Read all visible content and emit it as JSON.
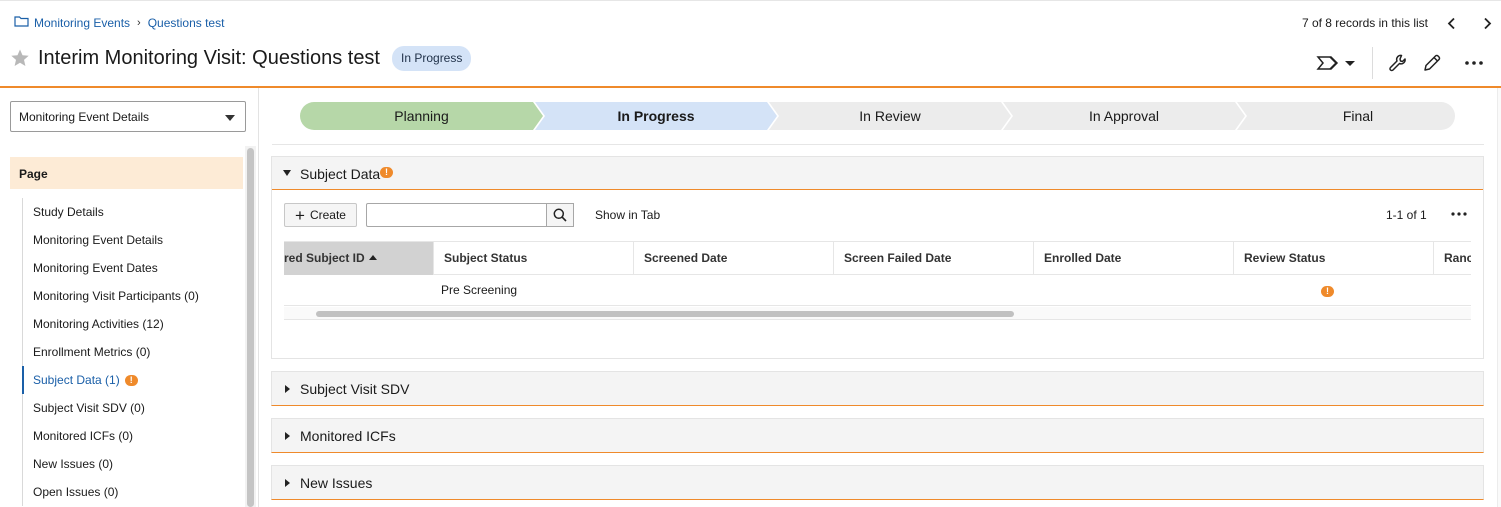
{
  "breadcrumb": {
    "folder_icon": "folder-icon",
    "parent": "Monitoring Events",
    "current": "Questions test"
  },
  "record_nav": {
    "count_text": "7 of 8 records in this list"
  },
  "header": {
    "title": "Interim Monitoring Visit: Questions test",
    "status_badge": "In Progress"
  },
  "sidebar": {
    "view_select": "Monitoring Event Details",
    "section_header": "Page",
    "items": [
      {
        "label": "Study Details"
      },
      {
        "label": "Monitoring Event Details"
      },
      {
        "label": "Monitoring Event Dates"
      },
      {
        "label": "Monitoring Visit Participants (0)"
      },
      {
        "label": "Monitoring Activities (12)"
      },
      {
        "label": "Enrollment Metrics (0)"
      },
      {
        "label": "Subject Data (1)",
        "active": true,
        "warning": true
      },
      {
        "label": "Subject Visit SDV (0)"
      },
      {
        "label": "Monitored ICFs (0)"
      },
      {
        "label": "New Issues (0)"
      },
      {
        "label": "Open Issues (0)"
      }
    ]
  },
  "lifecycle": {
    "stages": [
      "Planning",
      "In Progress",
      "In Review",
      "In Approval",
      "Final"
    ],
    "current": "In Progress",
    "colors": {
      "completed": "#b6d7a8",
      "current": "#d4e3f7",
      "future": "#ececec"
    }
  },
  "subject_data": {
    "title": "Subject Data",
    "create_label": "Create",
    "search_value": "",
    "show_in_tab": "Show in Tab",
    "pager": "1-1 of 1",
    "columns": [
      "red Subject ID",
      "Subject Status",
      "Screened Date",
      "Screen Failed Date",
      "Enrolled Date",
      "Review Status",
      "Ranc"
    ],
    "rows": [
      {
        "subject_id": "",
        "subject_status": "Pre Screening",
        "screened_date": "",
        "screen_failed_date": "",
        "enrolled_date": "",
        "review_status_icon": "warning-icon"
      }
    ]
  },
  "sections": [
    {
      "title": "Subject Visit SDV"
    },
    {
      "title": "Monitored ICFs"
    },
    {
      "title": "New Issues"
    }
  ],
  "accent_color": "#ef8a2b",
  "link_color": "#1a5fa8"
}
